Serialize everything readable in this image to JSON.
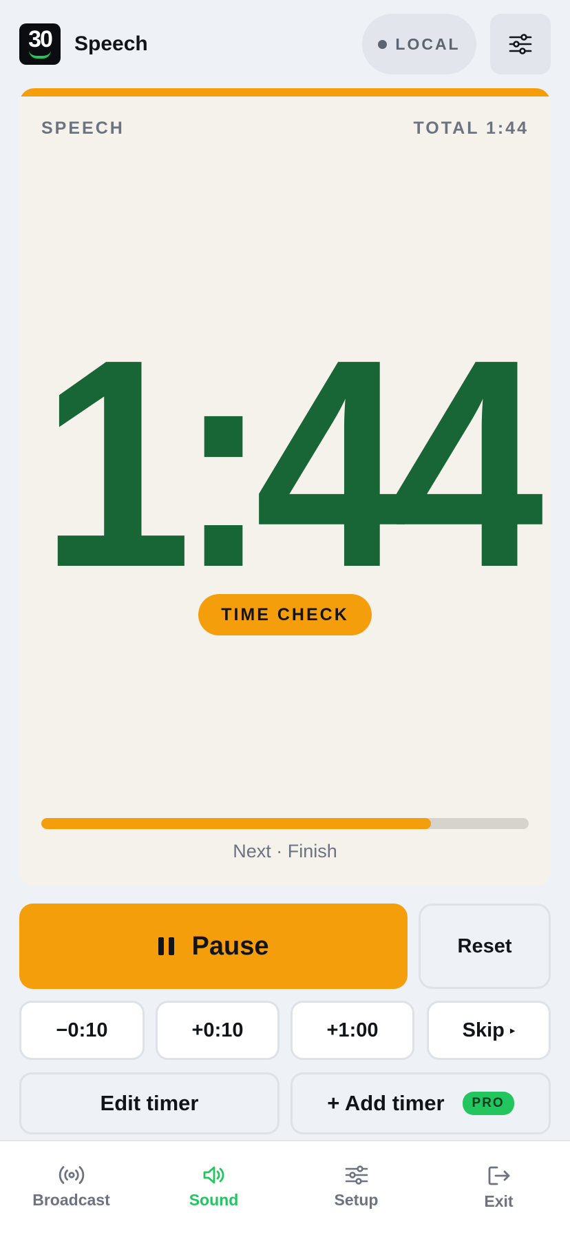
{
  "header": {
    "logo_text": "30",
    "app_title": "Speech",
    "mode_label": "LOCAL"
  },
  "timer": {
    "segment_label": "SPEECH",
    "total_label": "TOTAL 1:44",
    "remaining": "1:44",
    "badge": "TIME CHECK",
    "progress_fraction": 0.8,
    "next_label": "Next · Finish"
  },
  "controls": {
    "pause_label": "Pause",
    "reset_label": "Reset",
    "minus_10": "−0:10",
    "plus_10": "+0:10",
    "plus_1m": "+1:00",
    "skip_label": "Skip",
    "skip_arrow": "▸",
    "edit_label": "Edit timer",
    "add_label": "+ Add timer",
    "pro_badge": "PRO"
  },
  "nav": {
    "items": [
      {
        "label": "Broadcast",
        "icon": "broadcast-icon"
      },
      {
        "label": "Sound",
        "icon": "speaker-icon",
        "active": true
      },
      {
        "label": "Setup",
        "icon": "sliders-icon"
      },
      {
        "label": "Exit",
        "icon": "exit-icon"
      }
    ]
  },
  "colors": {
    "accent": "#f59e0b",
    "timer_green": "#186536",
    "active_green": "#22c55e",
    "background": "#eef1f5",
    "card": "#f5f2eb"
  }
}
